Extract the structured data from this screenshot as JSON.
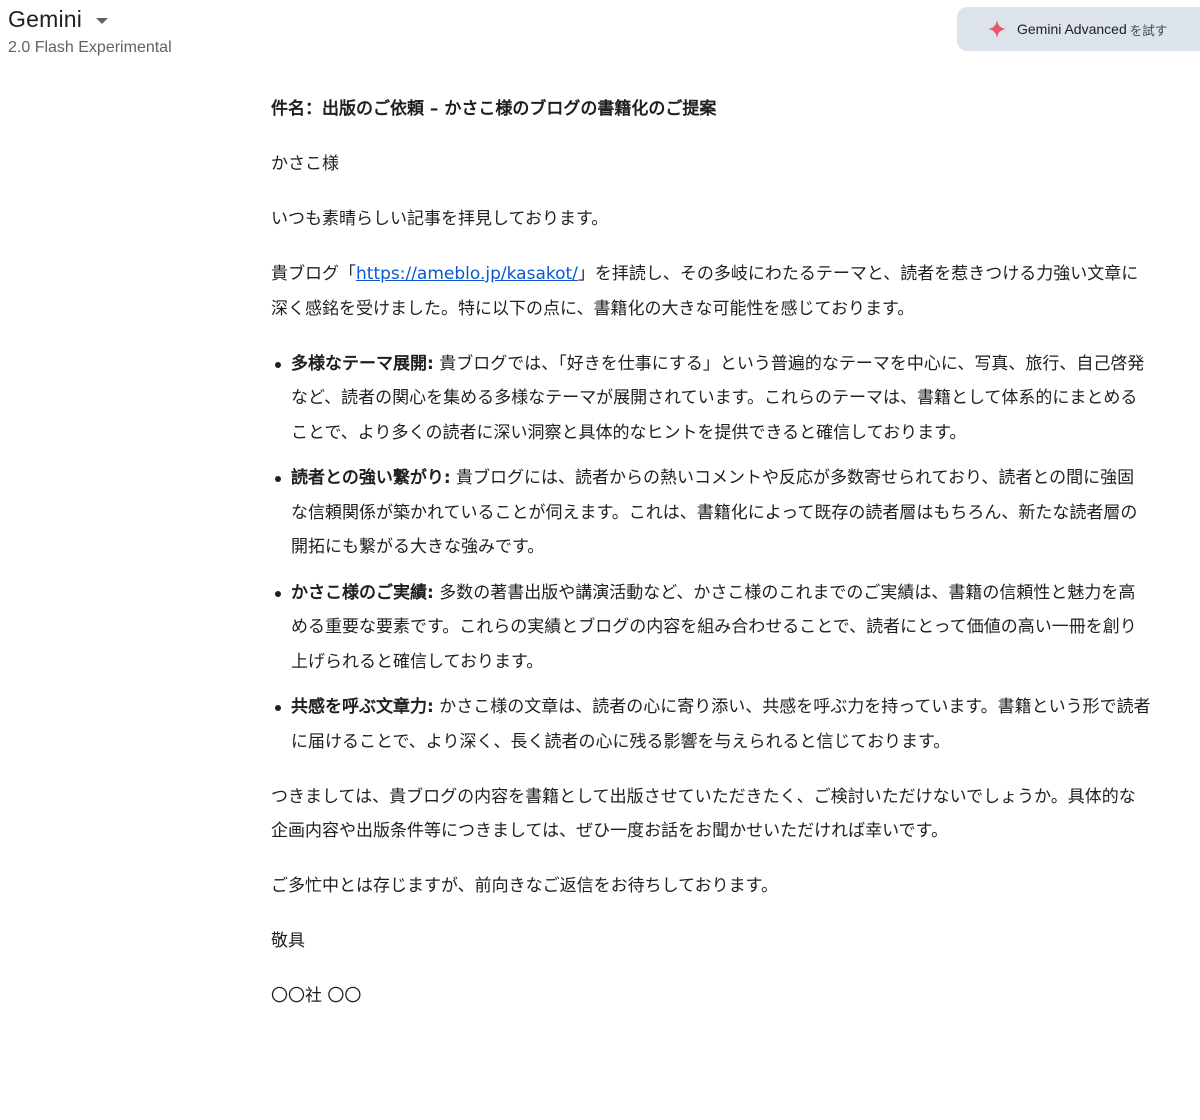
{
  "header": {
    "app_title": "Gemini",
    "model_name": "2.0 Flash Experimental",
    "upgrade_label": "Gemini Advanced",
    "upgrade_suffix": "を試す",
    "accent_color": "#e8546b"
  },
  "message": {
    "subject": "件名：出版のご依頼 – かさこ様のブログの書籍化のご提案",
    "salutation": "かさこ様",
    "greeting": "いつも素晴らしい記事を拝見しております。",
    "intro_before_link": "貴ブログ「",
    "intro_link": "https://ameblo.jp/kasakot/",
    "intro_after_link": "」を拝読し、その多岐にわたるテーマと、読者を惹きつける力強い文章に深く感銘を受けました。特に以下の点に、書籍化の大きな可能性を感じております。",
    "points": [
      {
        "title": "多様なテーマ展開:",
        "text": " 貴ブログでは、「好きを仕事にする」という普遍的なテーマを中心に、写真、旅行、自己啓発など、読者の関心を集める多様なテーマが展開されています。これらのテーマは、書籍として体系的にまとめることで、より多くの読者に深い洞察と具体的なヒントを提供できると確信しております。"
      },
      {
        "title": "読者との強い繋がり:",
        "text": " 貴ブログには、読者からの熱いコメントや反応が多数寄せられており、読者との間に強固な信頼関係が築かれていることが伺えます。これは、書籍化によって既存の読者層はもちろん、新たな読者層の開拓にも繋がる大きな強みです。"
      },
      {
        "title": "かさこ様のご実績:",
        "text": " 多数の著書出版や講演活動など、かさこ様のこれまでのご実績は、書籍の信頼性と魅力を高める重要な要素です。これらの実績とブログの内容を組み合わせることで、読者にとって価値の高い一冊を創り上げられると確信しております。"
      },
      {
        "title": "共感を呼ぶ文章力:",
        "text": " かさこ様の文章は、読者の心に寄り添い、共感を呼ぶ力を持っています。書籍という形で読者に届けることで、より深く、長く読者の心に残る影響を与えられると信じております。"
      }
    ],
    "request": "つきましては、貴ブログの内容を書籍として出版させていただきたく、ご検討いただけないでしょうか。具体的な企画内容や出版条件等につきましては、ぜひ一度お話をお聞かせいただければ幸いです。",
    "closing_request": "ご多忙中とは存じますが、前向きなご返信をお待ちしております。",
    "closing": "敬具",
    "signature": "〇〇社 〇〇"
  }
}
